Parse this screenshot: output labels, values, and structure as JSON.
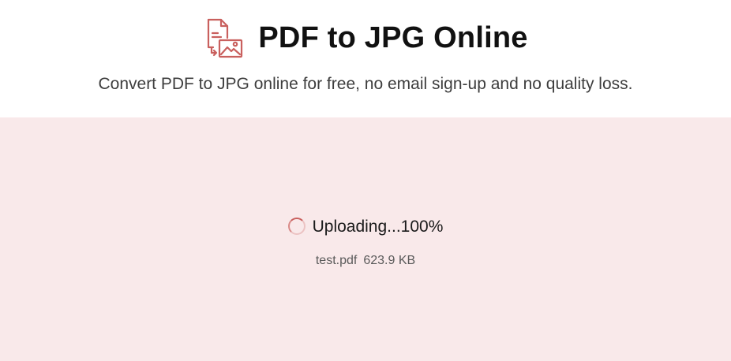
{
  "header": {
    "icon": "pdf-to-image-icon",
    "title": "PDF to JPG Online",
    "subtitle": "Convert PDF to JPG online for free, no email sign-up and no quality loss."
  },
  "upload": {
    "status": "Uploading...100%",
    "progress_percent": 100,
    "file_name": "test.pdf",
    "file_size": "623.9 KB"
  },
  "colors": {
    "accent": "#c9605e",
    "upload_background": "#f9e9ea"
  }
}
